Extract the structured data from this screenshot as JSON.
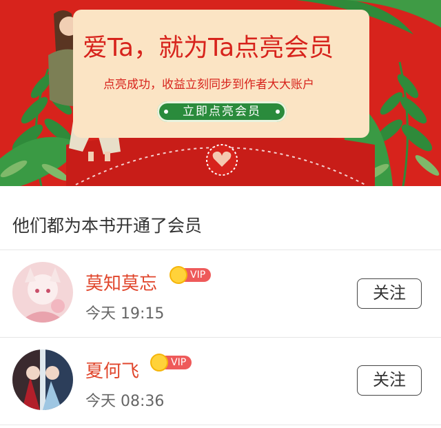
{
  "banner": {
    "headline": "爱Ta，就为Ta点亮会员",
    "subline": "点亮成功，收益立刻同步到作者大大账户",
    "cta_label": "立即点亮会员",
    "colors": {
      "background": "#d7231c",
      "card": "#fbe4c4",
      "cta": "#2a8b3c",
      "leaf": "#2f8a3a"
    }
  },
  "section_title": "他们都为本书开通了会员",
  "members": [
    {
      "name": "莫知莫忘",
      "badge": "VIP",
      "time": "今天 19:15",
      "follow_label": "关注"
    },
    {
      "name": "夏何飞",
      "badge": "VIP",
      "time": "今天 08:36",
      "follow_label": "关注"
    }
  ]
}
